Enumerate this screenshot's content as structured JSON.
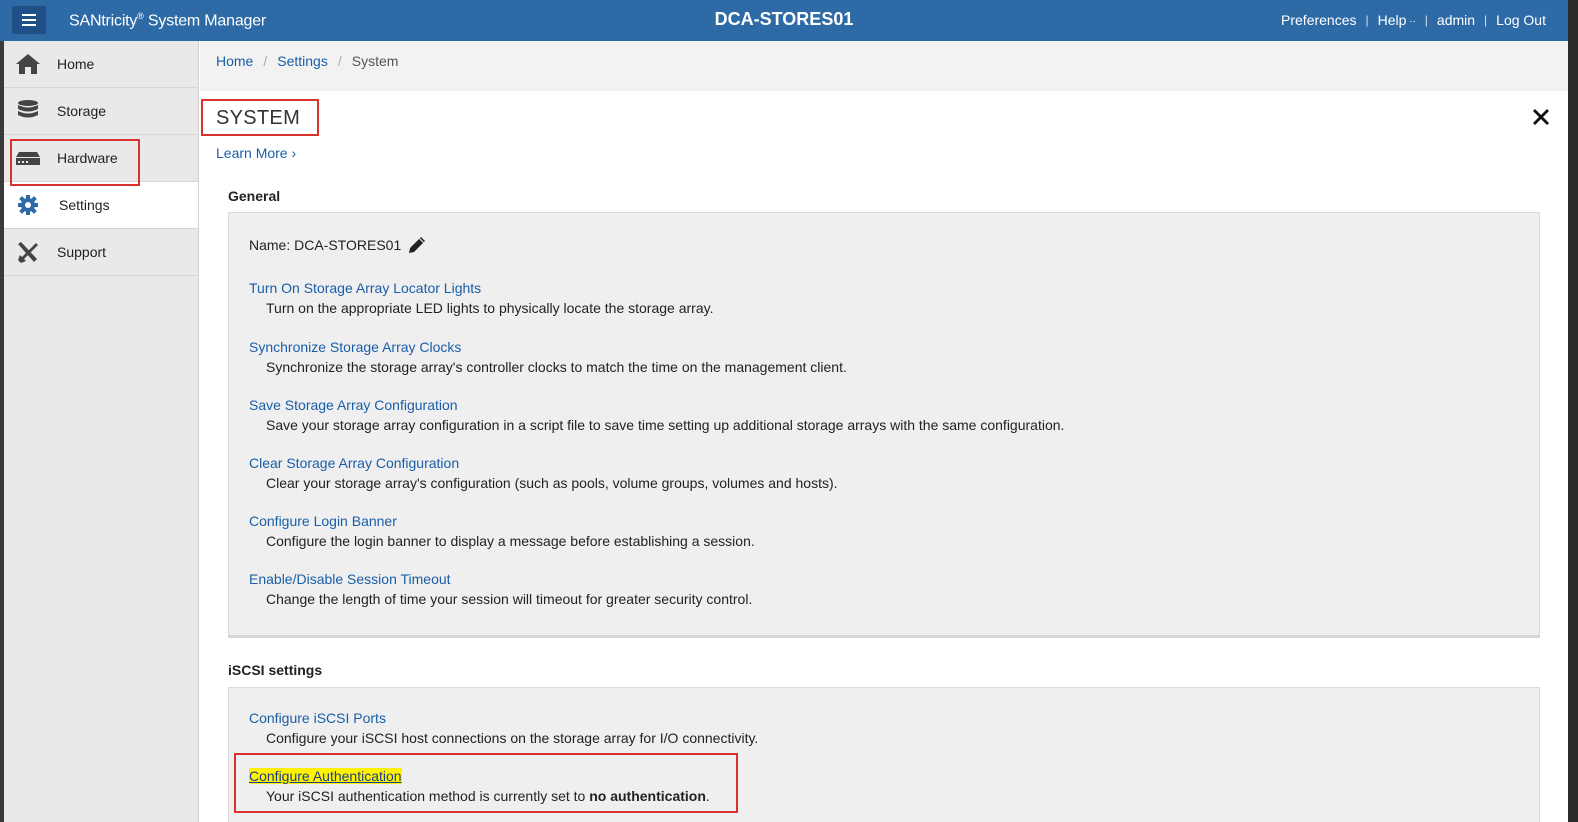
{
  "header": {
    "app_name": "SANtricity",
    "app_reg": "®",
    "app_suffix": " System Manager",
    "array_name": "DCA-STORES01",
    "links": {
      "preferences": "Preferences",
      "help": "Help",
      "user": "admin",
      "logout": "Log Out"
    }
  },
  "sidebar": {
    "items": [
      {
        "label": "Home",
        "icon": "home-icon"
      },
      {
        "label": "Storage",
        "icon": "database-icon"
      },
      {
        "label": "Hardware",
        "icon": "hardware-icon"
      },
      {
        "label": "Settings",
        "icon": "gear-icon",
        "active": true
      },
      {
        "label": "Support",
        "icon": "tools-icon"
      }
    ]
  },
  "breadcrumb": {
    "home": "Home",
    "settings": "Settings",
    "current": "System"
  },
  "page": {
    "title": "SYSTEM",
    "learn_more": "Learn More ›"
  },
  "general": {
    "heading": "General",
    "name_label": "Name: DCA-STORES01",
    "items": [
      {
        "link": "Turn On Storage Array Locator Lights",
        "desc": "Turn on the appropriate LED lights to physically locate the storage array."
      },
      {
        "link": "Synchronize Storage Array Clocks",
        "desc": "Synchronize the storage array's controller clocks to match the time on the management client."
      },
      {
        "link": "Save Storage Array Configuration",
        "desc": "Save your storage array configuration in a script file to save time setting up additional storage arrays with the same configuration."
      },
      {
        "link": "Clear Storage Array Configuration",
        "desc": "Clear your storage array's configuration (such as pools, volume groups, volumes and hosts)."
      },
      {
        "link": "Configure Login Banner",
        "desc": "Configure the login banner to display a message before establishing a session."
      },
      {
        "link": "Enable/Disable Session Timeout",
        "desc": "Change the length of time your session will timeout for greater security control."
      }
    ]
  },
  "iscsi": {
    "heading": "iSCSI settings",
    "items": [
      {
        "link": "Configure iSCSI Ports",
        "desc": "Configure your iSCSI host connections on the storage array for I/O connectivity."
      },
      {
        "link": "Configure Authentication",
        "desc_prefix": "Your iSCSI authentication method is currently set to ",
        "desc_bold": "no authentication",
        "desc_suffix": "."
      }
    ]
  },
  "colors": {
    "header_bg": "#2e6aa6",
    "link": "#1a5ea8",
    "highlight_box": "#d9312e",
    "text_highlight": "#fff200"
  }
}
